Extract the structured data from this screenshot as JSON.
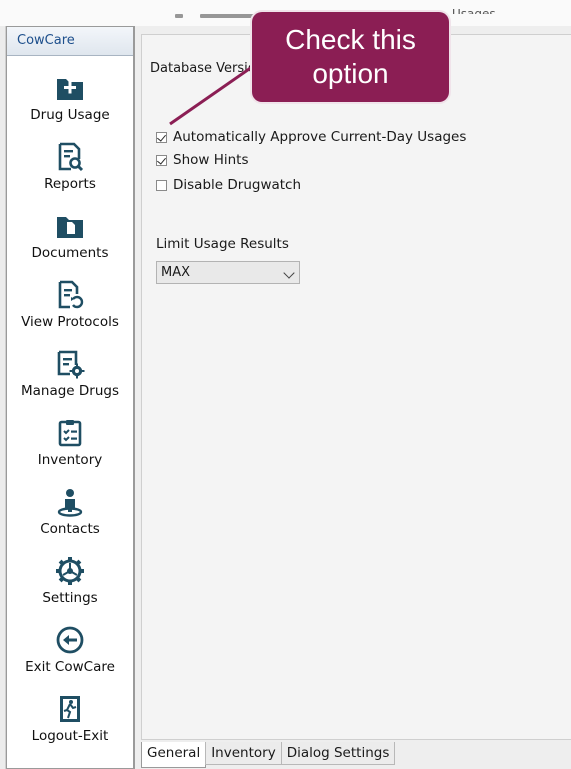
{
  "window": {
    "partial_top_text": "Usages"
  },
  "sidebar": {
    "header": "CowCare",
    "items": [
      {
        "label": "Drug Usage",
        "icon": "folder-plus-icon"
      },
      {
        "label": "Reports",
        "icon": "report-search-icon"
      },
      {
        "label": "Documents",
        "icon": "documents-folder-icon"
      },
      {
        "label": "View Protocols",
        "icon": "protocol-refresh-icon"
      },
      {
        "label": "Manage Drugs",
        "icon": "document-gear-icon"
      },
      {
        "label": "Inventory",
        "icon": "clipboard-check-icon"
      },
      {
        "label": "Contacts",
        "icon": "person-icon"
      },
      {
        "label": "Settings",
        "icon": "gear-icon"
      },
      {
        "label": "Exit CowCare",
        "icon": "exit-arrow-icon"
      },
      {
        "label": "Logout-Exit",
        "icon": "logout-door-icon"
      }
    ]
  },
  "settings": {
    "database_version_label": "Database Version",
    "options": [
      {
        "label": "Automatically Approve Current-Day Usages",
        "checked": true
      },
      {
        "label": "Show Hints",
        "checked": true
      },
      {
        "label": "Disable Drugwatch",
        "checked": false
      }
    ],
    "limit_label": "Limit Usage Results",
    "limit_value": "MAX"
  },
  "tabs": [
    "General",
    "Inventory",
    "Dialog Settings"
  ],
  "active_tab": "General",
  "callout": {
    "text": "Check this option",
    "color": "#8b1e54"
  },
  "colors": {
    "icon": "#1f4e63",
    "header_text": "#1d4f8c"
  }
}
